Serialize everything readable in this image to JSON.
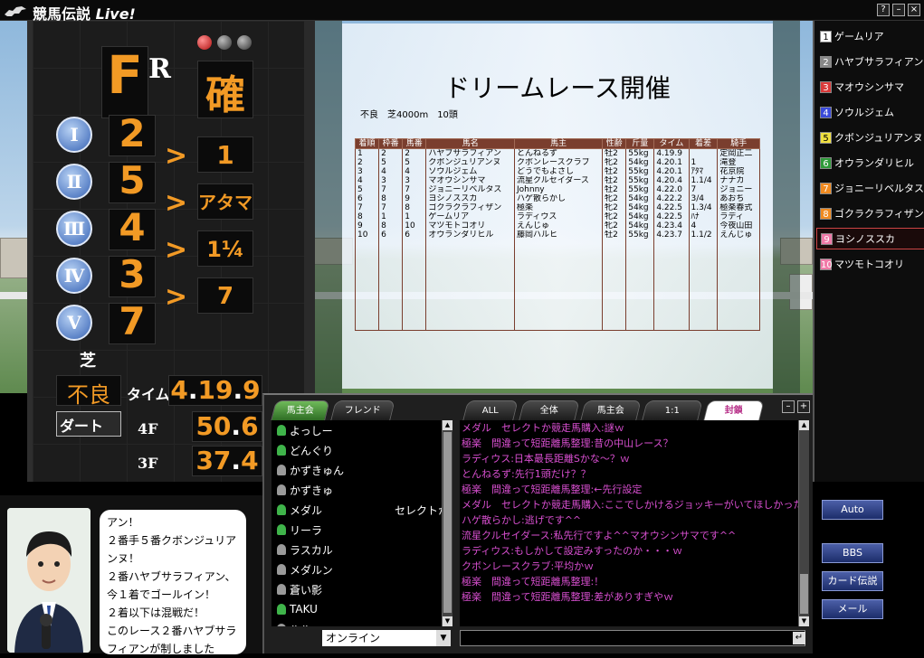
{
  "window": {
    "title_main": "競馬伝説",
    "title_live": "Live!",
    "buttons": [
      "?",
      "–",
      "×"
    ]
  },
  "tote": {
    "type_letter": "F",
    "r_letter": "R",
    "status": "確",
    "rows": [
      {
        "roman": "Ⅰ",
        "horse": "2",
        "margin": "1"
      },
      {
        "roman": "Ⅱ",
        "horse": "5",
        "margin": "アタマ"
      },
      {
        "roman": "Ⅲ",
        "horse": "4",
        "margin": "1¼"
      },
      {
        "roman": "Ⅳ",
        "horse": "3",
        "margin": "7"
      },
      {
        "roman": "Ⅴ",
        "horse": "7",
        "margin": ""
      }
    ],
    "surface_turf": "芝",
    "going": "不良",
    "surface_dirt": "ダート",
    "time_label": "タイム",
    "time": {
      "m": "4",
      "s": "19",
      "t": "9"
    },
    "f4_label": "4F",
    "f4": {
      "s": "50",
      "t": "6"
    },
    "f3_label": "3F",
    "f3": {
      "s": "37",
      "t": "4"
    }
  },
  "results": {
    "title": "ドリームレース開催",
    "conditions": "不良　芝4000m　10頭",
    "columns": [
      "着順",
      "枠番",
      "馬番",
      "馬名",
      "馬主",
      "性齢",
      "斤量",
      "タイム",
      "着差",
      "騎手"
    ],
    "rows": [
      [
        "1",
        "2",
        "2",
        "ハヤブサラフィアン",
        "とんねるず",
        "牡2",
        "55kg",
        "4.19.9",
        "",
        "定岡正二"
      ],
      [
        "2",
        "5",
        "5",
        "クボンジュリアンヌ",
        "クボンレースクラブ",
        "牝2",
        "54kg",
        "4.20.1",
        "1",
        "滝登"
      ],
      [
        "3",
        "4",
        "4",
        "ソウルジェム",
        "どうでもよさし",
        "牡2",
        "55kg",
        "4.20.1",
        "ｱﾀﾏ",
        "花京院"
      ],
      [
        "4",
        "3",
        "3",
        "マオウシンサマ",
        "流星クルセイダース",
        "牡2",
        "55kg",
        "4.20.4",
        "1.1/4",
        "ナナカ"
      ],
      [
        "5",
        "7",
        "7",
        "ジョニーリベルタス",
        "Johnny",
        "牡2",
        "55kg",
        "4.22.0",
        "7",
        "ジョニー"
      ],
      [
        "6",
        "8",
        "9",
        "ヨシノススカ",
        "ハゲ散らかし",
        "牝2",
        "54kg",
        "4.22.2",
        "3/4",
        "あおち"
      ],
      [
        "7",
        "7",
        "8",
        "ゴクラクラフィザン",
        "極楽",
        "牝2",
        "54kg",
        "4.22.5",
        "1.3/4",
        "極楽春式"
      ],
      [
        "8",
        "1",
        "1",
        "ゲームリア",
        "ラディウス",
        "牝2",
        "54kg",
        "4.22.5",
        "ﾊﾅ",
        "ラディ"
      ],
      [
        "9",
        "8",
        "10",
        "マツモトコオリ",
        "えんじゅ",
        "牝2",
        "54kg",
        "4.23.4",
        "4",
        "今夜山田"
      ],
      [
        "10",
        "6",
        "6",
        "オウランダリヒル",
        "藤岡ハルヒ",
        "牡2",
        "55kg",
        "4.23.7",
        "1.1/2",
        "えんじゅ"
      ]
    ]
  },
  "horse_list": [
    {
      "num": "1",
      "name": "ゲームリア",
      "color": "#ffffff",
      "text": "#000000"
    },
    {
      "num": "2",
      "name": "ハヤブサラフィアン",
      "color": "#888888",
      "text": "#ffffff"
    },
    {
      "num": "3",
      "name": "マオウシンサマ",
      "color": "#d93a3a",
      "text": "#ffffff"
    },
    {
      "num": "4",
      "name": "ソウルジェム",
      "color": "#3a4ad9",
      "text": "#ffffff"
    },
    {
      "num": "5",
      "name": "クボンジュリアンヌ",
      "color": "#f0e040",
      "text": "#000000"
    },
    {
      "num": "6",
      "name": "オウランダリヒル",
      "color": "#2f9a3a",
      "text": "#ffffff"
    },
    {
      "num": "7",
      "name": "ジョニーリベルタス",
      "color": "#f08a20",
      "text": "#ffffff"
    },
    {
      "num": "8",
      "name": "ゴクラクラフィザン",
      "color": "#f08a20",
      "text": "#ffffff"
    },
    {
      "num": "9",
      "name": "ヨシノススカ",
      "color": "#f07aa8",
      "text": "#ffffff"
    },
    {
      "num": "10",
      "name": "マツモトコオリ",
      "color": "#f07aa8",
      "text": "#ffffff"
    }
  ],
  "commentary": {
    "text": "アン！\n２番手５番クボンジュリアンヌ！\n２番ハヤブサラフィアン、今１着でゴールイン！\n２着以下は混戦だ！\nこのレース２番ハヤブサラフィアンが制しました"
  },
  "chat": {
    "left_tabs": [
      "馬主会",
      "フレンド"
    ],
    "right_tabs": [
      "ALL",
      "全体",
      "馬主会",
      "1:1",
      "封鎖"
    ],
    "members": [
      {
        "name": "よっしー",
        "online": true,
        "extra": ""
      },
      {
        "name": "どんぐり",
        "online": true,
        "extra": ""
      },
      {
        "name": "かずきゅん",
        "online": false,
        "extra": ""
      },
      {
        "name": "かずきゅ",
        "online": false,
        "extra": ""
      },
      {
        "name": "メダル",
        "online": true,
        "extra": "セレクトか"
      },
      {
        "name": "リーラ",
        "online": true,
        "extra": ""
      },
      {
        "name": "ラスカル",
        "online": false,
        "extra": ""
      },
      {
        "name": "メダルン",
        "online": false,
        "extra": ""
      },
      {
        "name": "蒼い影",
        "online": false,
        "extra": ""
      },
      {
        "name": "TAKU",
        "online": true,
        "extra": ""
      },
      {
        "name": "ルル",
        "online": false,
        "extra": ""
      }
    ],
    "messages": [
      "メダル　セレクトか競走馬購入:謎ｗ",
      "極楽　間違って短距離馬整理:昔の中山レース？",
      "ラディウス:日本最長距離Sかな～？ｗ",
      "とんねるず:先行1頭だけ？？",
      "極楽　間違って短距離馬整理:←先行設定",
      "メダル　セレクトか競走馬購入:ここでしかけるジョッキーがいてほしかった",
      "ハゲ散らかし:逃げです^^",
      "流星クルセイダース:私先行ですよ^^マオウシンサマです^^",
      "ラディウス:もしかして設定みすったのか・・・ｗ",
      "クボンレースクラブ:平均かｗ",
      "極楽　間違って短距離馬整理:！",
      "極楽　間違って短距離馬整理:差がありすぎやｗ"
    ],
    "status_value": "オンライン"
  },
  "side_buttons": {
    "auto": "Auto",
    "bbs": "BBS",
    "card": "カード伝説",
    "mail": "メール"
  },
  "colors": {
    "tote_orange": "#f29a25",
    "chat_pink": "#d84fd0",
    "table_header": "#7a3e2e"
  }
}
